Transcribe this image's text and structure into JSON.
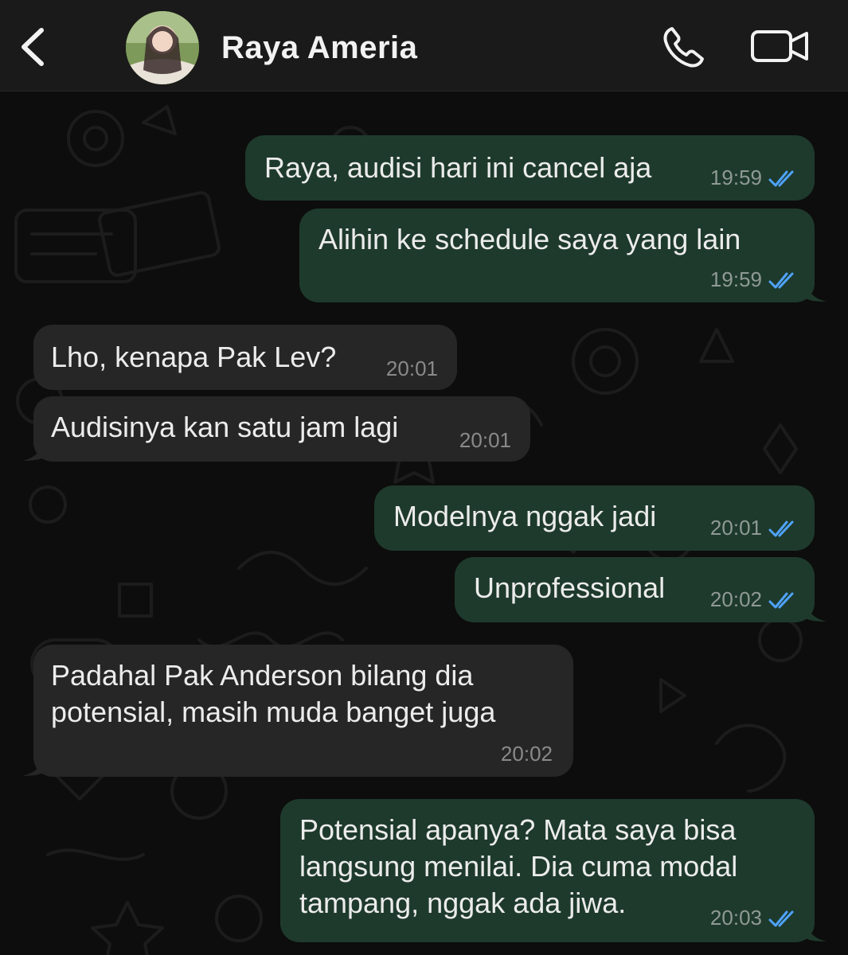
{
  "header": {
    "contact_name": "Raya Ameria",
    "back_icon": "chevron-left-icon",
    "call_icon": "phone-icon",
    "video_icon": "video-camera-icon"
  },
  "colors": {
    "header_bg": "#1a1a1a",
    "chat_bg": "#0d0d0d",
    "outgoing_bubble": "#1e3a2c",
    "incoming_bubble": "#262626",
    "read_ticks": "#4fa3ff"
  },
  "messages": [
    {
      "direction": "out",
      "text": "Raya, audisi hari ini cancel aja",
      "time": "19:59",
      "status": "read"
    },
    {
      "direction": "out",
      "text": "Alihin ke schedule saya yang lain",
      "time": "19:59",
      "status": "read"
    },
    {
      "direction": "in",
      "text": "Lho, kenapa Pak Lev?",
      "time": "20:01"
    },
    {
      "direction": "in",
      "text": "Audisinya kan satu jam lagi",
      "time": "20:01"
    },
    {
      "direction": "out",
      "text": "Modelnya nggak jadi",
      "time": "20:01",
      "status": "read"
    },
    {
      "direction": "out",
      "text": "Unprofessional",
      "time": "20:02",
      "status": "read"
    },
    {
      "direction": "in",
      "text": "Padahal Pak Anderson bilang dia\npotensial, masih muda banget juga",
      "time": "20:02"
    },
    {
      "direction": "out",
      "text": "Potensial apanya? Mata saya bisa\nlangsung menilai. Dia cuma modal\ntampang, nggak ada jiwa.",
      "time": "20:03",
      "status": "read"
    }
  ]
}
